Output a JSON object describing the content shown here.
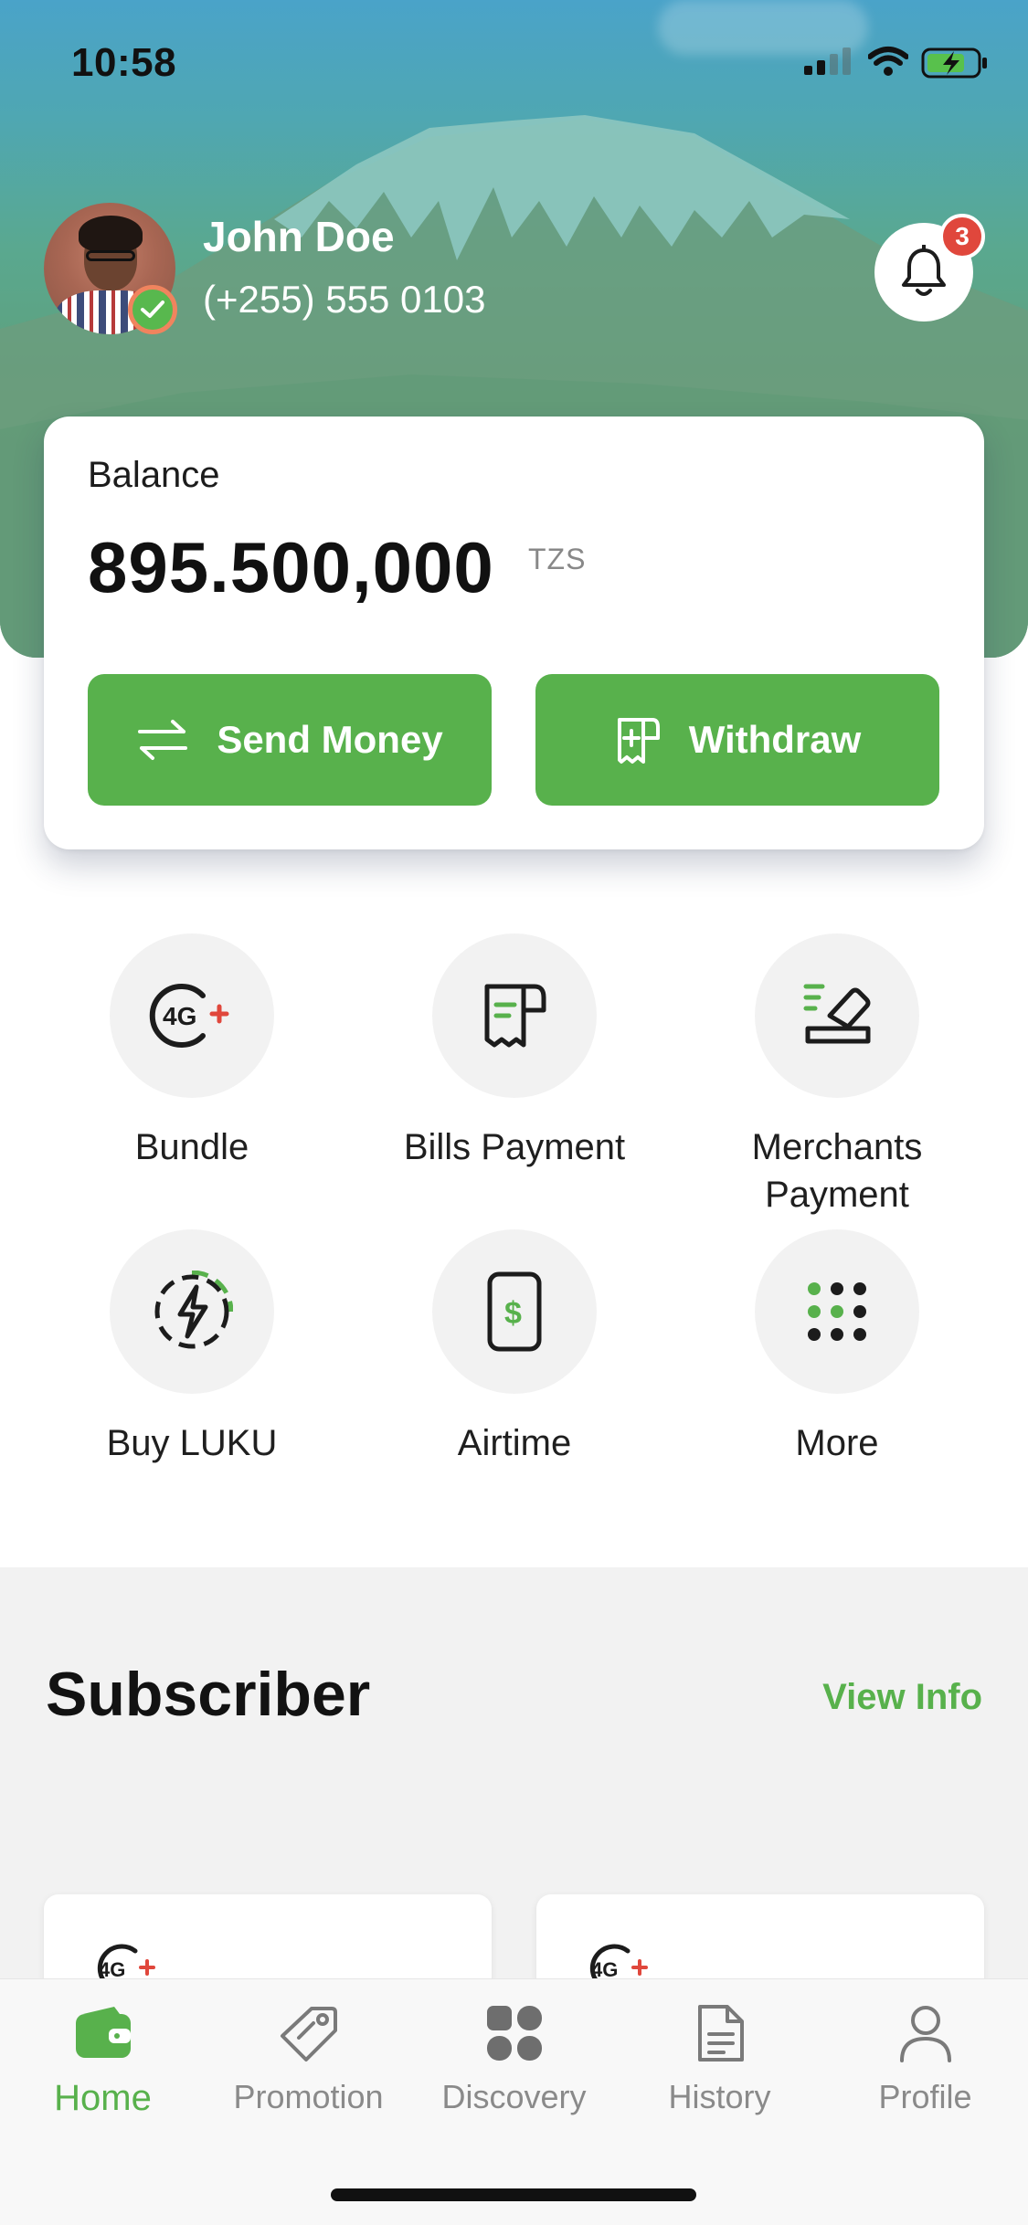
{
  "status": {
    "time": "10:58"
  },
  "profile": {
    "name": "John Doe",
    "phone": "(+255) 555 0103",
    "notifications": "3"
  },
  "balance": {
    "label": "Balance",
    "amount": "895.500,000",
    "currency": "TZS"
  },
  "actions": {
    "send_label": "Send Money",
    "withdraw_label": "Withdraw"
  },
  "services": [
    {
      "label": "Bundle",
      "icon": "4g-icon"
    },
    {
      "label": "Bills Payment",
      "icon": "receipt-icon"
    },
    {
      "label": "Merchants Payment",
      "icon": "merchant-icon"
    },
    {
      "label": "Buy LUKU",
      "icon": "lightning-icon"
    },
    {
      "label": "Airtime",
      "icon": "phone-dollar-icon"
    },
    {
      "label": "More",
      "icon": "grid-dots-icon"
    }
  ],
  "subscriber": {
    "title": "Subscriber",
    "view_info": "View Info"
  },
  "tabs": [
    {
      "label": "Home",
      "icon": "wallet-icon",
      "active": true
    },
    {
      "label": "Promotion",
      "icon": "tag-icon"
    },
    {
      "label": "Discovery",
      "icon": "apps-icon"
    },
    {
      "label": "History",
      "icon": "document-icon"
    },
    {
      "label": "Profile",
      "icon": "user-icon"
    }
  ],
  "colors": {
    "accent": "#58b14c",
    "badge": "#e0473c",
    "hero_top": "#4aa3c9",
    "hero_bottom": "#5c9678"
  }
}
